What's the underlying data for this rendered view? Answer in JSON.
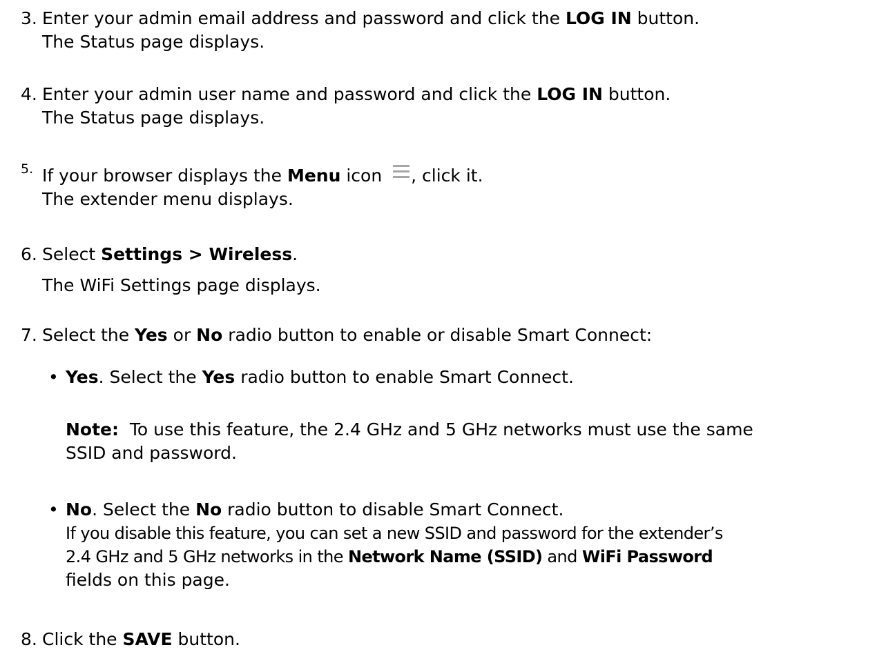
{
  "steps": [
    {
      "number": "3.",
      "pre": "Enter your admin email address and password and click the ",
      "bold": "LOG IN",
      "post": " button.",
      "line2": "The Status page displays."
    },
    {
      "number": "4.",
      "pre": "Enter your admin user name and password and click the ",
      "bold": "LOG IN",
      "post": " button.",
      "line2": "The Status page displays."
    },
    {
      "number": "5.",
      "pre": "If your browser displays the ",
      "bold": "Menu",
      "mid": " icon ",
      "icon": "hamburger-menu-icon",
      "post": ", click it.",
      "line2": "The extender menu displays."
    },
    {
      "number": "6.",
      "pre": "Select ",
      "bold": "Settings > Wireless",
      "post": ".",
      "line2": "The WiFi Settings page displays."
    },
    {
      "number": "7.",
      "pre": "Select the ",
      "bold": "Yes",
      "mid": " or ",
      "bold2": "No",
      "post": " radio button to enable or disable Smart Connect:"
    },
    {
      "number": "8.",
      "pre": "Click the ",
      "bold": "SAVE",
      "post": " button."
    }
  ],
  "bullets": {
    "yes": {
      "bold": "Yes",
      "mid": ". Select the ",
      "bold2": "Yes",
      "post": " radio button to enable Smart Connect."
    },
    "note": {
      "label": "Note:",
      "text": "  To use this feature, the 2.4 GHz and 5 GHz networks must use the same",
      "line2": "SSID and password."
    },
    "no": {
      "bold": "No",
      "mid": ". Select the ",
      "bold2": "No",
      "post": " radio button to disable Smart Connect.",
      "l2": "If you disable this feature, you can set a new SSID and password for the extender’s",
      "l3_pre": "2.4 GHz and 5 GHz networks in the ",
      "l3_bold": "Network Name (SSID)",
      "l3_mid": " and ",
      "l3_bold2": "WiFi Password",
      "l4": "fields on this page."
    },
    "bullet_char": "•"
  }
}
